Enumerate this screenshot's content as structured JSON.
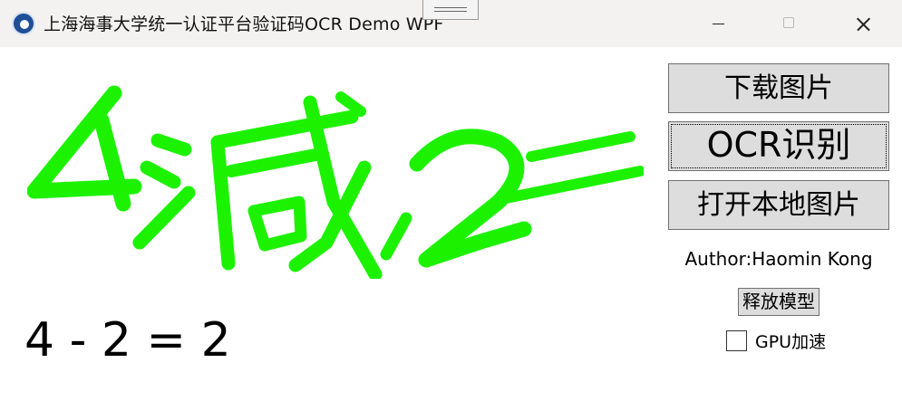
{
  "window": {
    "title": "上海海事大学统一认证平台验证码OCR Demo WPF"
  },
  "captcha": {
    "text": "4减2",
    "color": "#1cf200"
  },
  "result": "4 - 2 = 2",
  "buttons": {
    "download": "下载图片",
    "ocr": "OCR识别",
    "open_local": "打开本地图片",
    "release_model": "释放模型"
  },
  "author": "Author:Haomin Kong",
  "gpu": {
    "label": "GPU加速",
    "checked": false
  }
}
